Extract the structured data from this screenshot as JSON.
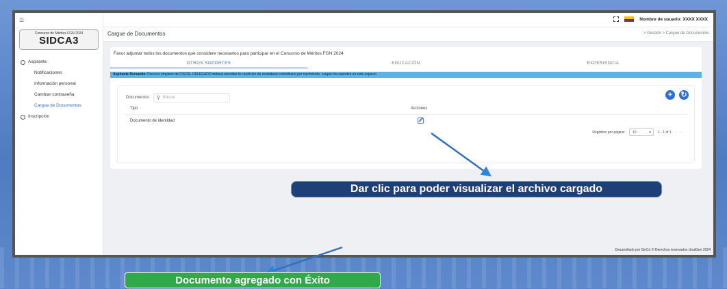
{
  "app": {
    "logo_caption": "Concurso de Méritos FGN 2024",
    "logo_text": "SIDCA3",
    "user_label": "Nombre de usuario: XXXX XXXX"
  },
  "sidebar": {
    "items": [
      {
        "label": "Aspirante",
        "icon": "user-icon"
      },
      {
        "label": "Notificaciones"
      },
      {
        "label": "Información personal"
      },
      {
        "label": "Cambiar contraseña"
      },
      {
        "label": "Cargue de Documentos",
        "active": true
      },
      {
        "label": "Inscripción",
        "icon": "user-icon"
      }
    ]
  },
  "header": {
    "title": "Cargue de Documentos",
    "breadcrumb": "> Gestión > Cargue de Documentos"
  },
  "card": {
    "intro": "Favor adjuntar todos los documentos que considere necesarios para participar en el Concurso de Méritos FGN 2024",
    "tabs": [
      "OTROS SOPORTES",
      "EDUCACIÓN",
      "EXPERIENCIA"
    ],
    "alert_bold": "Aspirante Recuerde:",
    "alert_text": "Para los empleos de FISCAL DELEGADO deberá acreditar la condición de ciudadano colombiano por nacimiento, cargue los soportes en este espacio."
  },
  "documents": {
    "label": "Documentos",
    "search_placeholder": "Buscar",
    "columns": [
      "Tipo",
      "Acciones"
    ],
    "rows": [
      {
        "tipo": "Documento de identidad"
      }
    ],
    "pager": {
      "label": "Registros por página:",
      "value": "10",
      "range": "1 - 1 of 1"
    }
  },
  "footer": {
    "text": "Desarrollado por SinCo © Derechos reservados UnalGen 2024"
  },
  "annotations": {
    "callout": "Dar clic para poder visualizar el archivo cargado",
    "toast": "Documento agregado con Éxito"
  },
  "colors": {
    "primary": "#2d6ddc",
    "alert_bg": "#5bb3e6",
    "callout_bg": "#1f3f79",
    "toast_bg": "#2fa94a"
  }
}
